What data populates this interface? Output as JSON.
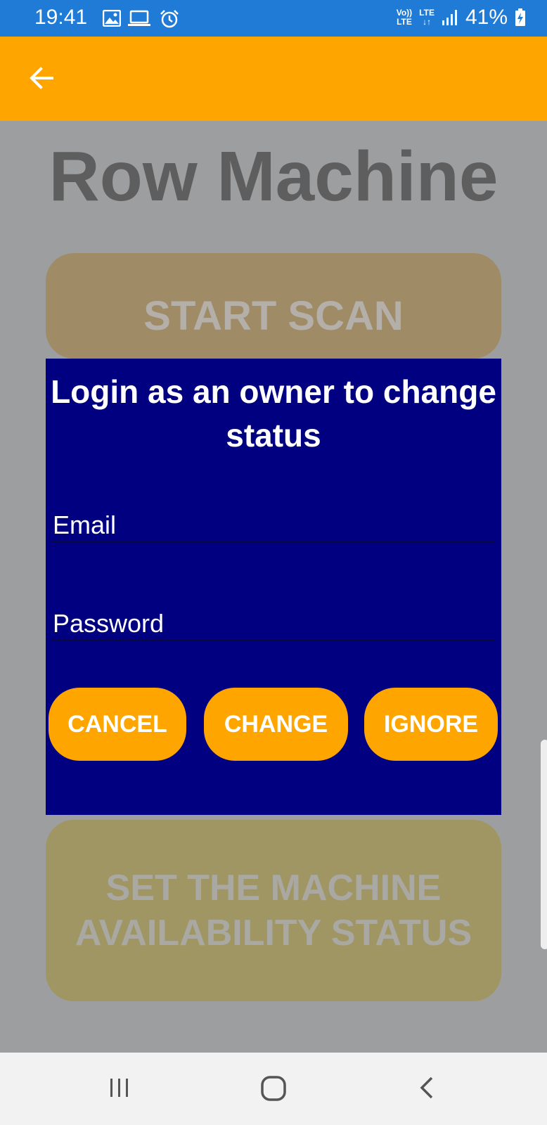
{
  "status_bar": {
    "time": "19:41",
    "network_top": "Vo))",
    "network_bottom": "LTE",
    "lte_label": "LTE",
    "battery_percent": "41%",
    "icons": [
      "image-icon",
      "laptop-icon",
      "alarm-icon",
      "signal-icon",
      "battery-charging-icon"
    ]
  },
  "app_bar": {
    "back_icon": "arrow-left-icon",
    "color": "#ffa500"
  },
  "main": {
    "title": "Row Machine",
    "start_scan_label": "START SCAN",
    "set_status_label": "SET THE MACHINE AVAILABILITY STATUS"
  },
  "dialog": {
    "title": "Login as an owner to change status",
    "email_placeholder": "Email",
    "password_placeholder": "Password",
    "cancel_label": "CANCEL",
    "change_label": "CHANGE",
    "ignore_label": "IGNORE",
    "background": "#000080",
    "button_color": "#ffa500"
  },
  "nav_bar": {
    "icons": [
      "recent-apps-icon",
      "home-icon",
      "back-icon"
    ]
  }
}
